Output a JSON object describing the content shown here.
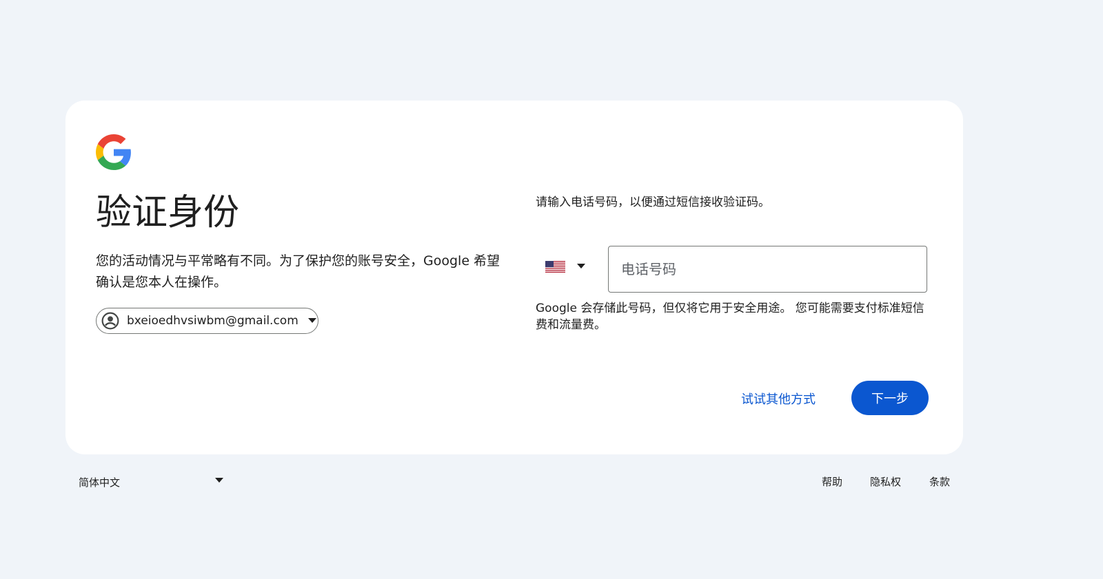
{
  "brand": {
    "logo_icon": "google-g-icon",
    "colors": {
      "blue": "#4285F4",
      "red": "#EA4335",
      "yellow": "#FBBC05",
      "green": "#34A853"
    }
  },
  "left": {
    "title": "验证身份",
    "description": "您的活动情况与平常略有不同。为了保护您的账号安全，Google 希望确认是您本人在操作。",
    "account": {
      "email": "bxeioedhvsiwbm@gmail.com",
      "icon": "account-circle-icon",
      "caret_icon": "chevron-down-icon"
    }
  },
  "right": {
    "instruction": "请输入电话号码，以便通过短信接收验证码。",
    "country": {
      "flag_icon": "us-flag-icon",
      "caret_icon": "chevron-down-icon"
    },
    "phone": {
      "placeholder": "电话号码",
      "value": ""
    },
    "notice": "Google 会存储此号码，但仅将它用于安全用途。 您可能需要支付标准短信费和流量费。"
  },
  "actions": {
    "try_another": "试试其他方式",
    "next": "下一步",
    "accent": "#0b57d0"
  },
  "footer": {
    "language": "简体中文",
    "links": {
      "help": "帮助",
      "privacy": "隐私权",
      "terms": "条款"
    }
  }
}
